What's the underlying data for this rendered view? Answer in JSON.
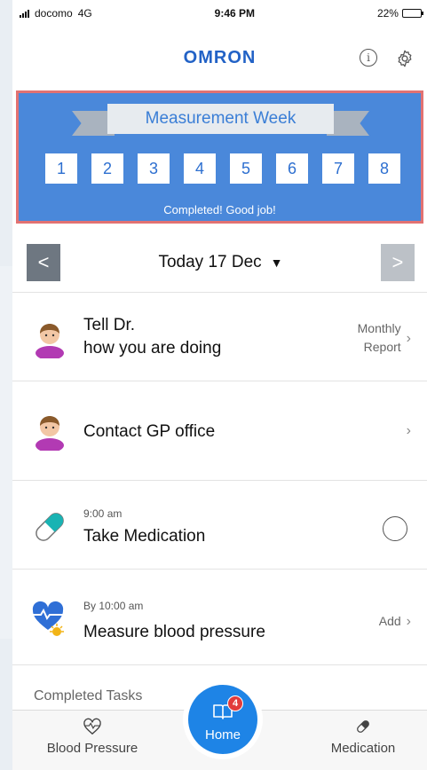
{
  "status_bar": {
    "carrier": "docomo",
    "network": "4G",
    "time": "9:46 PM",
    "battery": "22%",
    "battery_level": 0.22
  },
  "header": {
    "logo": "omron",
    "icons": [
      "info-icon",
      "gear-icon"
    ]
  },
  "measurement_week": {
    "title": "Measurement Week",
    "days": [
      "1",
      "2",
      "3",
      "4",
      "5",
      "6",
      "7",
      "8"
    ],
    "status": "Completed! Good job!",
    "colors": {
      "background": "#4a88da",
      "highlight_border": "#e27272"
    }
  },
  "date_nav": {
    "label": "Today 17 Dec",
    "prev": "<",
    "next": ">"
  },
  "tasks": [
    {
      "title_line1": "Tell Dr.",
      "title_line2": "how you are doing",
      "right_line1": "Monthly",
      "right_line2": "Report",
      "icon": "doctor-icon"
    },
    {
      "title": "Contact GP office",
      "icon": "doctor-icon"
    },
    {
      "time": "9:00 am",
      "title": "Take Medication",
      "icon": "pill-icon"
    },
    {
      "time": "By 10:00 am",
      "title": "Measure blood pressure",
      "action": "Add",
      "icon": "heart-sun-icon"
    }
  ],
  "completed_label": "Completed Tasks",
  "tabbar": {
    "blood_pressure": "Blood Pressure",
    "home": "Home",
    "home_badge": "4",
    "medication": "Medication",
    "accent": "#1e84e6"
  }
}
